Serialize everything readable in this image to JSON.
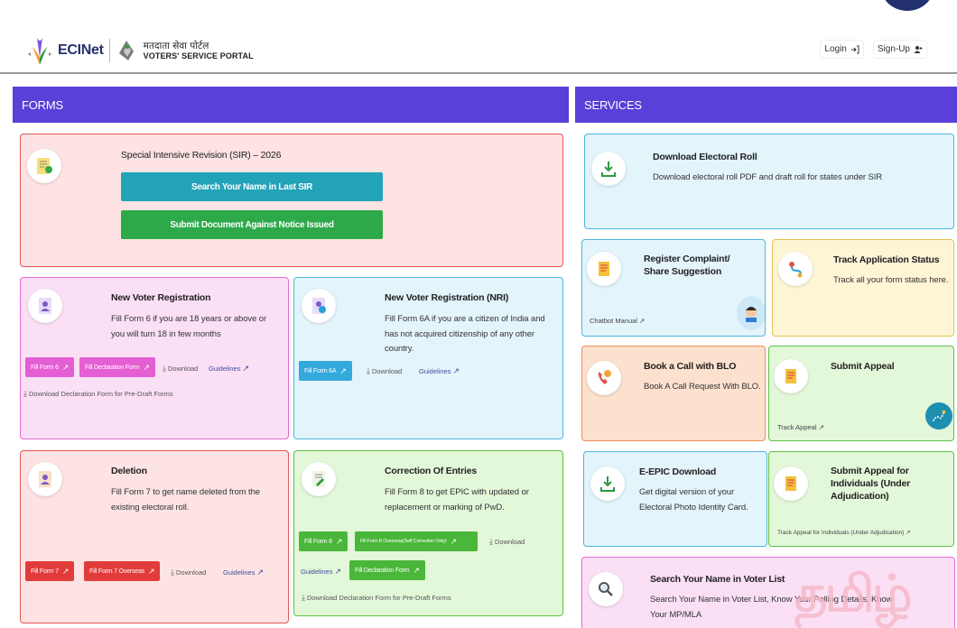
{
  "header": {
    "logo_text": "ECINet",
    "portal_hindi": "मतदाता सेवा पोर्टल",
    "portal_english": "VOTERS' SERVICE PORTAL",
    "login_label": "Login",
    "signup_label": "Sign-Up"
  },
  "forms": {
    "heading": "FORMS",
    "sir": {
      "title": "Special Intensive Revision (SIR) – 2026",
      "search_btn": "Search Your Name in Last SIR",
      "submit_btn": "Submit Document Against Notice Issued"
    },
    "new_voter": {
      "title": "New Voter Registration",
      "desc": "Fill Form 6 if you are 18 years or above or you will turn 18 in few months",
      "fill_form": "Fill Form 6",
      "fill_declaration": "Fill Declaration Form",
      "download": "Download",
      "guidelines": "Guidelines",
      "download_predraft": "Download Declaration Form for Pre-Draft Forms"
    },
    "new_voter_nri": {
      "title": "New Voter Registration (NRI)",
      "desc": "Fill Form 6A if you are a citizen of India and has not acquired citizenship of any other country.",
      "fill_form": "Fill Form 6A",
      "download": "Download",
      "guidelines": "Guidelines"
    },
    "deletion": {
      "title": "Deletion",
      "desc": "Fill Form 7 to get name deleted from the existing electoral roll.",
      "fill_form": "Fill Form 7",
      "fill_overseas": "Fill Form 7 Overseas",
      "download": "Download",
      "guidelines": "Guidelines"
    },
    "correction": {
      "title": "Correction Of Entries",
      "desc": "Fill Form 8 to get EPIC with updated or replacement or marking of PwD.",
      "fill_form": "Fill Form 8",
      "fill_overseas": "Fill Form 8 Overseas(Self Correction Only)",
      "download": "Download",
      "guidelines": "Guidelines",
      "fill_declaration": "Fill Declaration Form",
      "download_predraft": "Download Declaration Form for Pre-Draft Forms"
    }
  },
  "services": {
    "heading": "SERVICES",
    "electoral_roll": {
      "title": "Download Electoral Roll",
      "desc": "Download electoral roll PDF and draft roll for states under SIR"
    },
    "complaint": {
      "title": "Register Complaint/ Share Suggestion",
      "link": "Chatbot Manual"
    },
    "track_status": {
      "title": "Track Application Status",
      "desc": "Track all your form status here."
    },
    "blo": {
      "title": "Book a Call with BLO",
      "desc": "Book A Call Request With BLO."
    },
    "appeal": {
      "title": "Submit Appeal",
      "link": "Track Appeal"
    },
    "epic": {
      "title": "E-EPIC Download",
      "desc": "Get digital version of your Electoral Photo Identity Card."
    },
    "appeal_individuals": {
      "title": "Submit Appeal for Individuals (Under Adjudication)",
      "link": "Track Appeal for Individuals (Under Adjudication)"
    },
    "search_name": {
      "title": "Search Your Name in Voter List",
      "desc": "Search Your Name in Voter List, Know Your Polling Details, Know Your MP/MLA"
    }
  },
  "watermark": "தமிழ்",
  "colors": {
    "header_purple": "#5a3fd8",
    "sir_search_btn": "#23a3b8",
    "sir_submit_btn": "#2ea94a",
    "pink_btn": "#e45fd3",
    "blue_btn": "#33a9dc",
    "red_btn": "#e23b3b",
    "green_btn": "#4ab63a"
  }
}
